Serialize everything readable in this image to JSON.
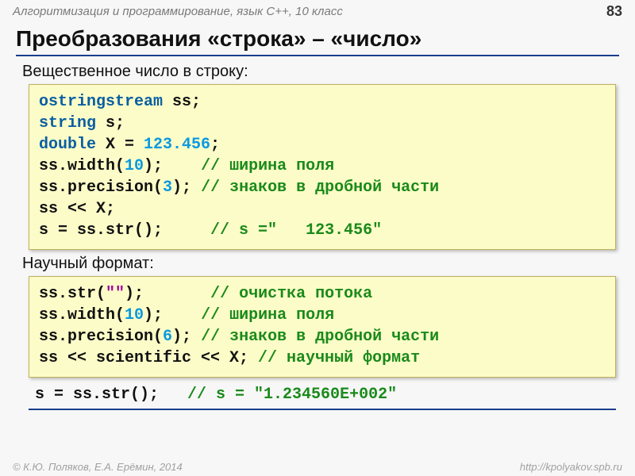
{
  "header": {
    "course": "Алгоритмизация и программирование, язык С++, 10 класс",
    "page_number": "83"
  },
  "title": "Преобразования «строка» – «число»",
  "section1": {
    "heading": "Вещественное число в строку:",
    "code": {
      "l1a": "ostringstream",
      "l1b": " ss;",
      "l2a": "string",
      "l2b": " s;",
      "l3a": "double",
      "l3b": " X = ",
      "l3c": "123.456",
      "l3d": ";",
      "l4a": "ss.width(",
      "l4b": "10",
      "l4c": ");    ",
      "l4d": "// ширина поля",
      "l5a": "ss.precision(",
      "l5b": "3",
      "l5c": "); ",
      "l5d": "// знаков в дробной части",
      "l6": "ss << X;",
      "l7a": "s = ss.str();     ",
      "l7b": "// s =\"   123.456\""
    }
  },
  "section2": {
    "heading": "Научный формат:",
    "code": {
      "l1a": "ss.str(",
      "l1b": "\"\"",
      "l1c": ");       ",
      "l1d": "// очистка потока",
      "l2a": "ss.width(",
      "l2b": "10",
      "l2c": ");    ",
      "l2d": "// ширина поля",
      "l3a": "ss.precision(",
      "l3b": "6",
      "l3c": "); ",
      "l3d": "// знаков в дробной части",
      "l4a": "ss << scientific << X; ",
      "l4b": "// научный формат"
    },
    "result": {
      "a": "s = ss.str();   ",
      "b": "// s = \"1.234560E+002\""
    }
  },
  "footer": {
    "left": "© К.Ю. Поляков, Е.А. Ерёмин, 2014",
    "right": "http://kpolyakov.spb.ru"
  }
}
